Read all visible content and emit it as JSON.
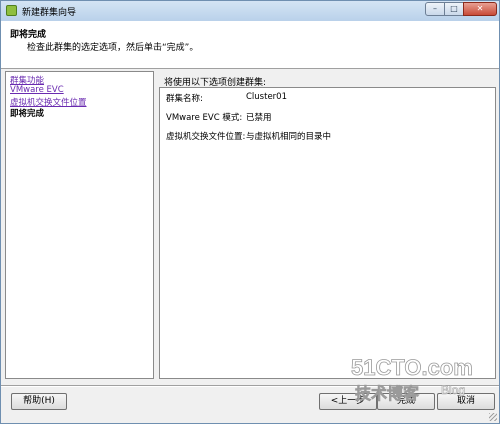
{
  "window": {
    "title": "新建群集向导",
    "controls": {
      "minimize": "–",
      "maximize": "□",
      "close": "✕"
    }
  },
  "header": {
    "title": "即将完成",
    "description": "检查此群集的选定选项，然后单击“完成”。"
  },
  "nav": {
    "items": [
      {
        "label": "群集功能",
        "state": "link"
      },
      {
        "label": "VMware EVC",
        "state": "link"
      },
      {
        "label": "虚拟机交换文件位置",
        "state": "link"
      },
      {
        "label": "即将完成",
        "state": "current"
      }
    ]
  },
  "content": {
    "label": "将使用以下选项创建群集:",
    "rows": [
      {
        "label": "群集名称:",
        "value": "Cluster01"
      },
      {
        "label": "VMware EVC 模式:",
        "value": "已禁用"
      },
      {
        "label": "虚拟机交换文件位置:",
        "value": "与虚拟机相同的目录中"
      }
    ]
  },
  "buttons": {
    "help": "帮助(H)",
    "back": "<上一步",
    "finish": "完成",
    "cancel": "取消"
  },
  "watermark": {
    "site": "51CTO.com",
    "tagline": "技术博客",
    "blog": "Blog"
  },
  "colors": {
    "titlebar": "#c6dbf0",
    "link": "#6a2bb0",
    "close_button": "#c84a37"
  }
}
